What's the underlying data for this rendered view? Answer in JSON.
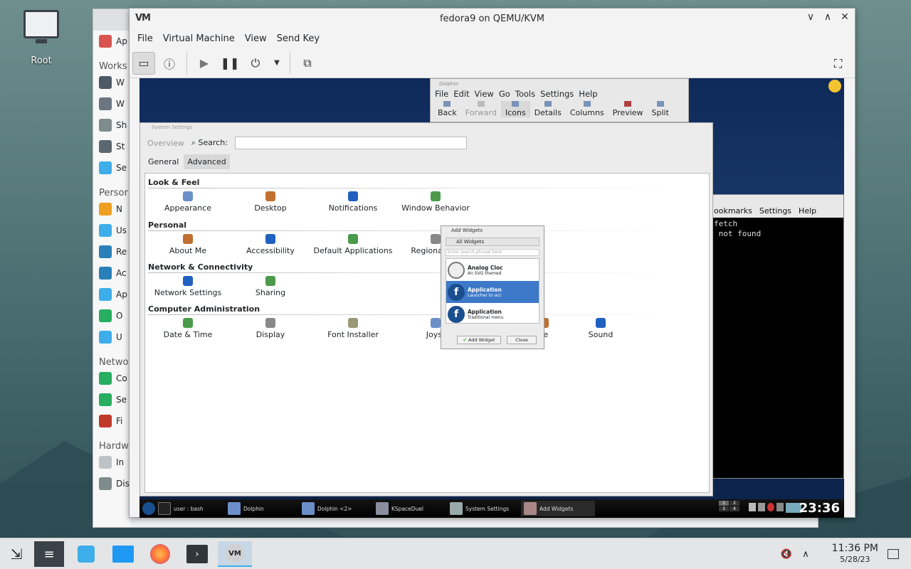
{
  "desktop": {
    "icon_label": "Root"
  },
  "kde_settings_bg": {
    "sidebar": [
      {
        "type": "item",
        "label": "Ap",
        "color": "#d9534f"
      },
      {
        "type": "header",
        "label": "Works"
      },
      {
        "type": "item",
        "label": "W",
        "color": "#4d5a66"
      },
      {
        "type": "item",
        "label": "W",
        "color": "#6b7680"
      },
      {
        "type": "item",
        "label": "Sh",
        "color": "#7f8c8d"
      },
      {
        "type": "item",
        "label": "St",
        "color": "#5a6670"
      },
      {
        "type": "item",
        "label": "Se",
        "color": "#3daee9"
      },
      {
        "type": "header",
        "label": "Persor"
      },
      {
        "type": "item",
        "label": "N",
        "color": "#f0a020"
      },
      {
        "type": "item",
        "label": "Us",
        "color": "#3daee9"
      },
      {
        "type": "item",
        "label": "Re",
        "color": "#2980b9"
      },
      {
        "type": "item",
        "label": "Ac",
        "color": "#2980b9"
      },
      {
        "type": "item",
        "label": "Ap",
        "color": "#3daee9"
      },
      {
        "type": "item",
        "label": "O",
        "color": "#27ae60"
      },
      {
        "type": "item",
        "label": "U",
        "color": "#3daee9"
      },
      {
        "type": "header",
        "label": "Netwo"
      },
      {
        "type": "item",
        "label": "Co",
        "color": "#27ae60"
      },
      {
        "type": "item",
        "label": "Se",
        "color": "#27ae60"
      },
      {
        "type": "item",
        "label": "Fi",
        "color": "#c0392b"
      },
      {
        "type": "header",
        "label": "Hardw"
      },
      {
        "type": "item",
        "label": "In",
        "color": "#bdc3c7"
      },
      {
        "type": "item",
        "label": "Display and Monitor",
        "color": "#7f8c8d"
      }
    ]
  },
  "vm_window": {
    "title": "fedora9 on QEMU/KVM",
    "logo": "VM",
    "menu": [
      "File",
      "Virtual Machine",
      "View",
      "Send Key"
    ],
    "controls": {
      "minimize": "∨",
      "maximize": "∧",
      "close": "✕"
    }
  },
  "guest": {
    "dolphin": {
      "title": "Dolphin",
      "menu": [
        "File",
        "Edit",
        "View",
        "Go",
        "Tools",
        "Settings",
        "Help"
      ],
      "toolbar": [
        "Back",
        "Forward",
        "Icons",
        "Details",
        "Columns",
        "Preview",
        "Split"
      ]
    },
    "terminal": {
      "menu": [
        "ookmarks",
        "Settings",
        "Help"
      ],
      "lines": [
        "fetch",
        " not found"
      ]
    },
    "system_settings": {
      "title": "System Settings",
      "overview": "Overview",
      "search_label": "Search:",
      "tabs": [
        "General",
        "Advanced"
      ],
      "categories": [
        {
          "name": "Look & Feel",
          "items": [
            "Appearance",
            "Desktop",
            "Notifications",
            "Window Behavior"
          ]
        },
        {
          "name": "Personal",
          "items": [
            "About Me",
            "Accessibility",
            "Default Applications",
            "Regional & L"
          ]
        },
        {
          "name": "Network & Connectivity",
          "items": [
            "Network Settings",
            "Sharing"
          ]
        },
        {
          "name": "Computer Administration",
          "items": [
            "Date & Time",
            "Display",
            "Font Installer",
            "Joyst",
            "se",
            "Sound"
          ]
        }
      ]
    },
    "add_widgets": {
      "title": "Add Widgets",
      "filter": "All Widgets",
      "search_placeholder": "Enter search phrase here",
      "widgets": [
        {
          "name": "Analog Cloc",
          "desc": "An SVG themed"
        },
        {
          "name": "Application",
          "desc": "Launcher to acc"
        },
        {
          "name": "Application",
          "desc": "Traditional menu"
        }
      ],
      "add_button": "Add Widget",
      "close_button": "Close"
    },
    "taskbar": {
      "tasks": [
        "user : bash",
        "Dolphin",
        "Dolphin <2>",
        "KSpaceDuel",
        "System Settings",
        "Add Widgets"
      ],
      "pager": [
        "1",
        "2",
        "3",
        "4"
      ],
      "clock": "23:36"
    }
  },
  "host_taskbar": {
    "time": "11:36 PM",
    "date": "5/28/23"
  }
}
